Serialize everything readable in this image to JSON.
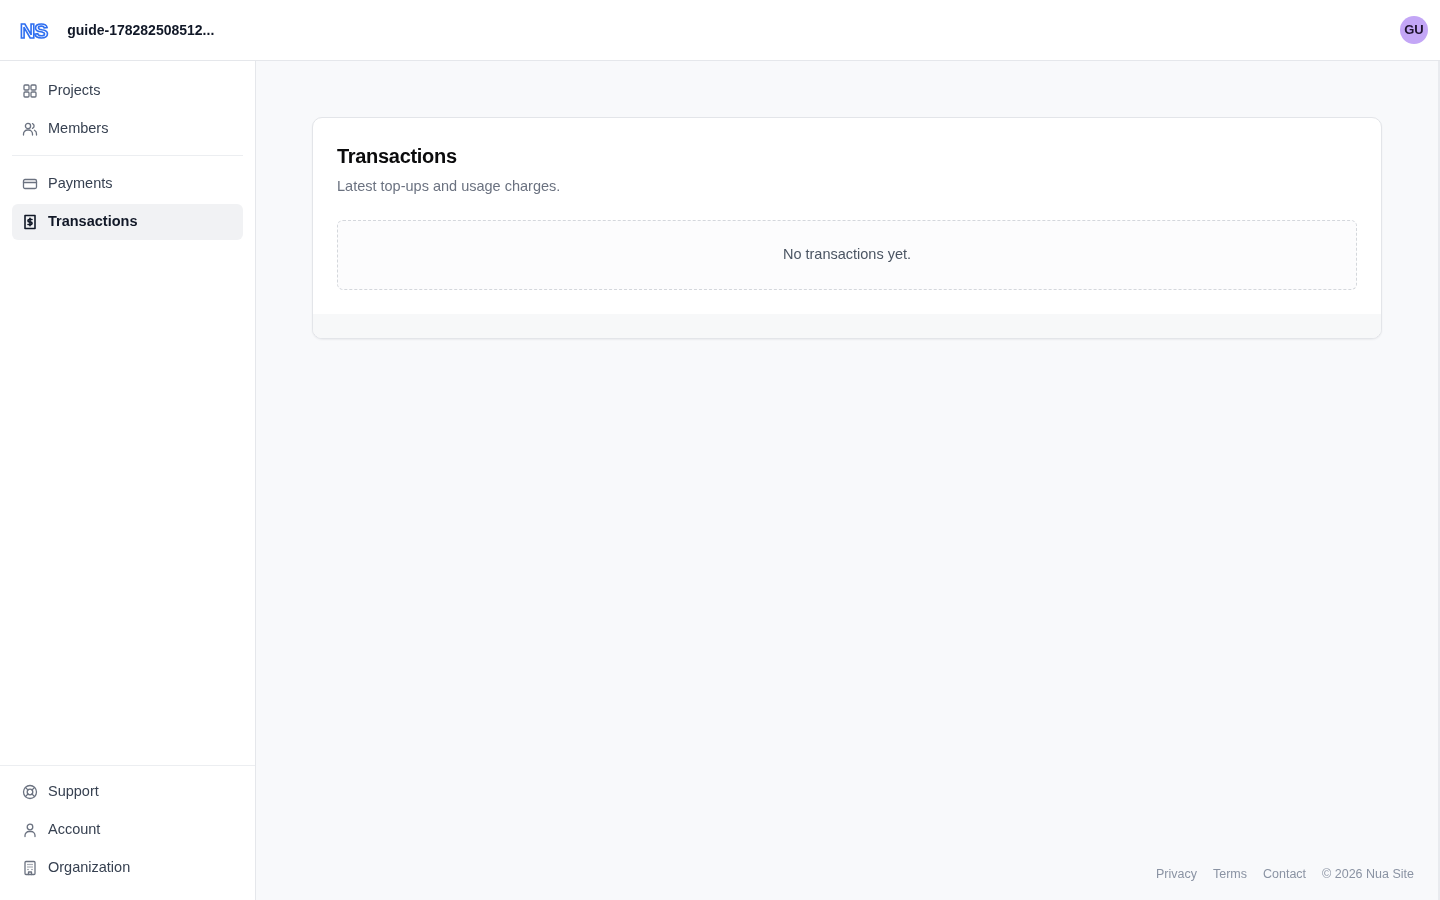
{
  "header": {
    "logo_text": "NS",
    "workspace": "guide-178282508512...",
    "avatar": "GU"
  },
  "sidebar": {
    "nav_groups": [
      {
        "items": [
          {
            "label": "Projects",
            "selected": false
          },
          {
            "label": "Members",
            "selected": false
          }
        ]
      },
      {
        "items": [
          {
            "label": "Payments",
            "selected": false
          },
          {
            "label": "Transactions",
            "selected": true
          }
        ]
      }
    ],
    "bottom_items": [
      {
        "label": "Support",
        "selected": false
      },
      {
        "label": "Account",
        "selected": false
      },
      {
        "label": "Organization",
        "selected": false
      }
    ]
  },
  "card": {
    "title": "Transactions",
    "subtitle": "Latest top-ups and usage charges.",
    "empty_message": "No transactions yet."
  },
  "footer": {
    "links": [
      "Privacy",
      "Terms",
      "Contact"
    ],
    "copyright": "© 2026 Nua Site"
  }
}
